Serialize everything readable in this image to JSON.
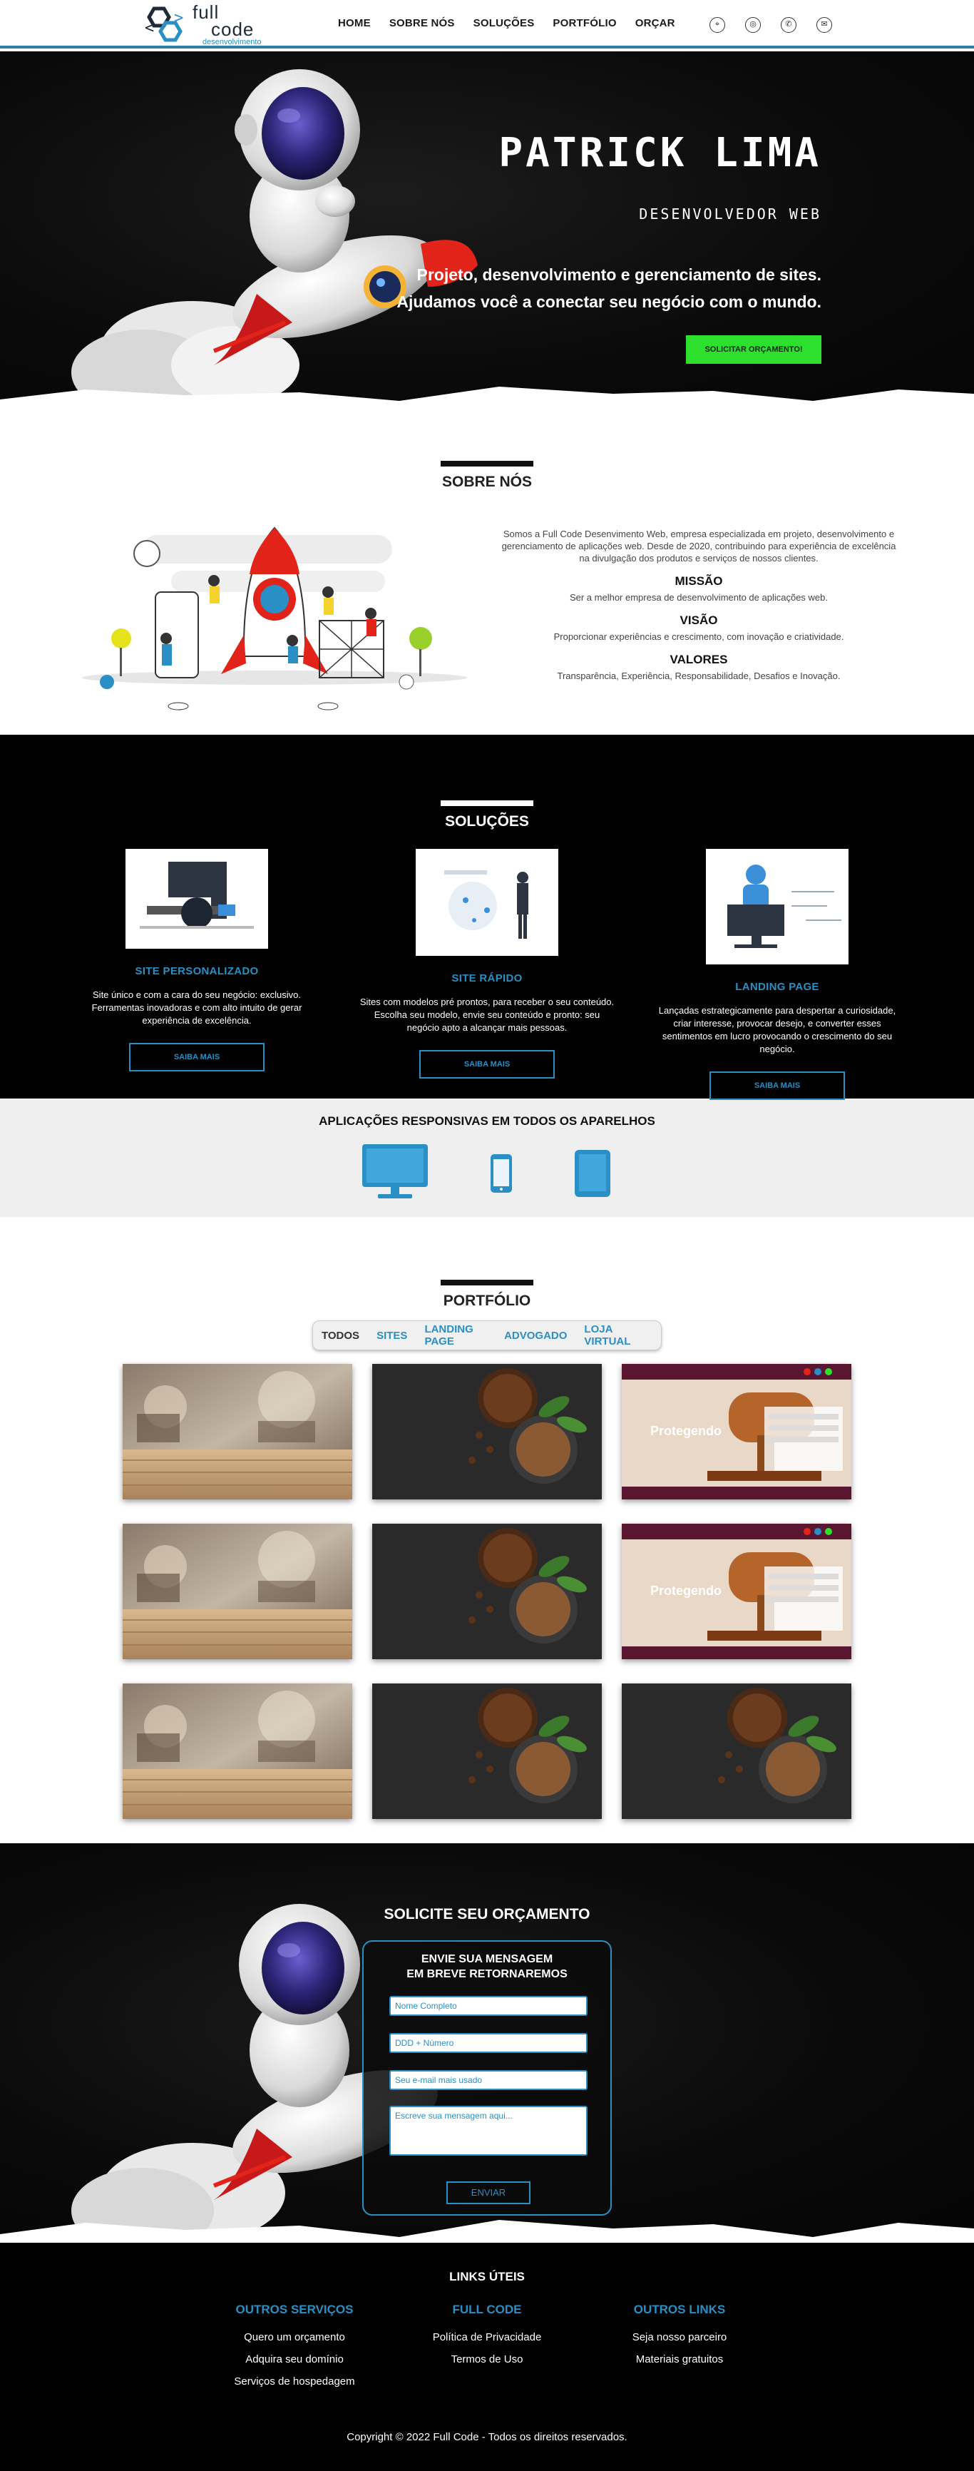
{
  "header": {
    "logo": {
      "word1": "full",
      "word2": "code",
      "word3": "desenvolvimento"
    },
    "nav": [
      "HOME",
      "SOBRE NÓS",
      "SOLUÇÕES",
      "PORTFÓLIO",
      "ORÇAR"
    ],
    "social_icons": [
      "location-icon",
      "instagram-icon",
      "whatsapp-icon",
      "mail-icon"
    ]
  },
  "hero": {
    "title": "PATRICK LIMA",
    "subtitle": "DESENVOLVEDOR WEB",
    "line1": "Projeto, desenvolvimento e gerenciamento de sites.",
    "line2": "Ajudamos você a conectar seu negócio com o mundo.",
    "cta": "SOLICITAR ORÇAMENTO!"
  },
  "sobre": {
    "title": "SOBRE NÓS",
    "intro": "Somos a Full Code Desenvimento Web, empresa especializada em projeto, desenvolvimento e gerenciamento de aplicações web. Desde de 2020, contribuindo para experiência de excelência na divulgação dos produtos e serviços de nossos clientes.",
    "missao_title": "MISSÃO",
    "missao": "Ser a melhor empresa de desenvolvimento de aplicações web.",
    "visao_title": "VISÃO",
    "visao": "Proporcionar experiências e crescimento, com inovação e criatividade.",
    "valores_title": "VALORES",
    "valores": "Transparência, Experiência, Responsabilidade, Desafios e Inovação."
  },
  "solucoes": {
    "title": "SOLUÇÕES",
    "cards": [
      {
        "title": "SITE PERSONALIZADO",
        "text": "Site único e com a cara do seu negócio: exclusivo. Ferramentas inovadoras e com alto intuito de gerar experiência de excelência.",
        "button": "SAIBA MAIS"
      },
      {
        "title": "SITE RÁPIDO",
        "text": "Sites com modelos pré prontos, para receber o seu conteúdo. Escolha seu modelo, envie seu conteúdo e pronto: seu negócio apto a alcançar mais pessoas.",
        "button": "SAIBA MAIS"
      },
      {
        "title": "LANDING PAGE",
        "text": "Lançadas estrategicamente para despertar a curiosidade, criar interesse, provocar desejo, e converter esses sentimentos em lucro provocando o crescimento do seu negócio.",
        "button": "SAIBA MAIS"
      }
    ]
  },
  "responsive": {
    "title": "APLICAÇÕES RESPONSIVAS EM TODOS OS APARELHOS"
  },
  "portfolio": {
    "title": "PORTFÓLIO",
    "filters": [
      "TODOS",
      "SITES",
      "LANDING PAGE",
      "ADVOGADO",
      "LOJA VIRTUAL"
    ],
    "active_filter": "TODOS",
    "items_row1": [
      "cafe",
      "coffee",
      "law"
    ],
    "items_row2": [
      "cafe",
      "coffee",
      "law"
    ],
    "items_row3": [
      "cafe",
      "coffee",
      "coffee"
    ],
    "law_text": "Protegendo"
  },
  "contato": {
    "title": "SOLICITE SEU ORÇAMENTO",
    "form_title_1": "ENVIE SUA MENSAGEM",
    "form_title_2": "EM BREVE RETORNAREMOS",
    "name_placeholder": "Nome Completo",
    "phone_placeholder": "DDD + Número",
    "email_placeholder": "Seu e-mail mais usado",
    "message_placeholder": "Escreve sua mensagem aqui...",
    "send": "ENVIAR"
  },
  "footer": {
    "title": "LINKS ÚTEIS",
    "col1": {
      "title": "OUTROS SERVIÇOS",
      "links": [
        "Quero um orçamento",
        "Adquira seu domínio",
        "Serviços de hospedagem"
      ]
    },
    "col2": {
      "title": "FULL CODE",
      "links": [
        "Política de Privacidade",
        "Termos de Uso"
      ]
    },
    "col3": {
      "title": "OUTROS LINKS",
      "links": [
        "Seja nosso parceiro",
        "Materiais gratuitos"
      ]
    },
    "copyright": "Copyright © 2022 Full Code - Todos os direitos reservados."
  },
  "colors": {
    "accent": "#2a8fc4",
    "cta": "#2ee02e",
    "dark": "#000000"
  }
}
